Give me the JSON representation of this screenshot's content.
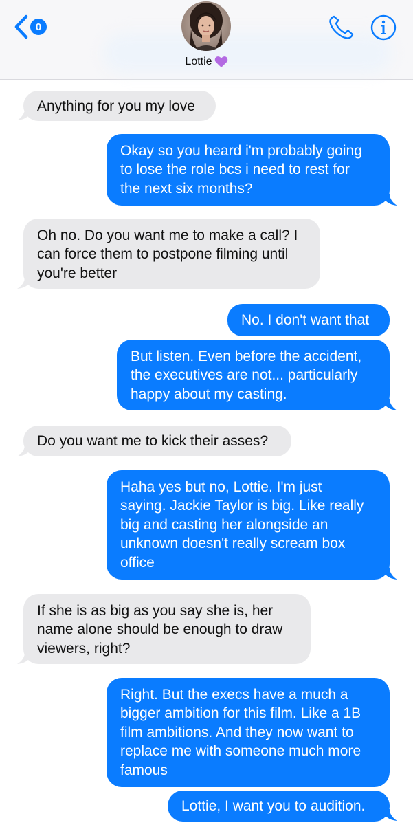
{
  "header": {
    "back_badge_count": "0",
    "contact_name": "Lottie",
    "accent_color": "#0a7cff"
  },
  "messages": [
    {
      "direction": "received",
      "lines": [
        "Anything for you my love"
      ]
    },
    {
      "direction": "sent",
      "lines": [
        "Okay so you heard i'm probably going",
        "to lose the role bcs i need to rest for",
        "the next six months?"
      ]
    },
    {
      "direction": "received",
      "lines": [
        "Oh no. Do you want me to make a call? I",
        "can force them to postpone filming until",
        "you're better"
      ]
    },
    {
      "direction": "sent",
      "lines": [
        "No. I don't want that"
      ]
    },
    {
      "direction": "sent",
      "lines": [
        "But listen. Even before the accident,",
        "the executives are not... particularly",
        "happy about my casting."
      ]
    },
    {
      "direction": "received",
      "lines": [
        "Do you want me to kick their asses?"
      ]
    },
    {
      "direction": "sent",
      "lines": [
        "Haha yes but no, Lottie. I'm just",
        "saying. Jackie Taylor is big. Like really",
        "big and casting her alongside an",
        "unknown doesn't really scream box",
        "office"
      ]
    },
    {
      "direction": "received",
      "lines": [
        "If she is as big as you say she is, her",
        "name alone should be enough to draw",
        "viewers, right?"
      ]
    },
    {
      "direction": "sent",
      "lines": [
        "Right. But the execs have a much a",
        "bigger ambition for this film. Like a 1B",
        "film ambitions. And they now want to",
        "replace me with someone much more",
        "famous"
      ]
    },
    {
      "direction": "sent",
      "lines": [
        "Lottie, I want you to audition."
      ]
    }
  ],
  "colors": {
    "sent_bubble": "#0a7cff",
    "received_bubble": "#e9e9eb",
    "sent_text": "#ffffff",
    "received_text": "#111111"
  },
  "icons": [
    "chevron-left-icon",
    "phone-icon",
    "info-icon",
    "purple-heart-icon"
  ]
}
